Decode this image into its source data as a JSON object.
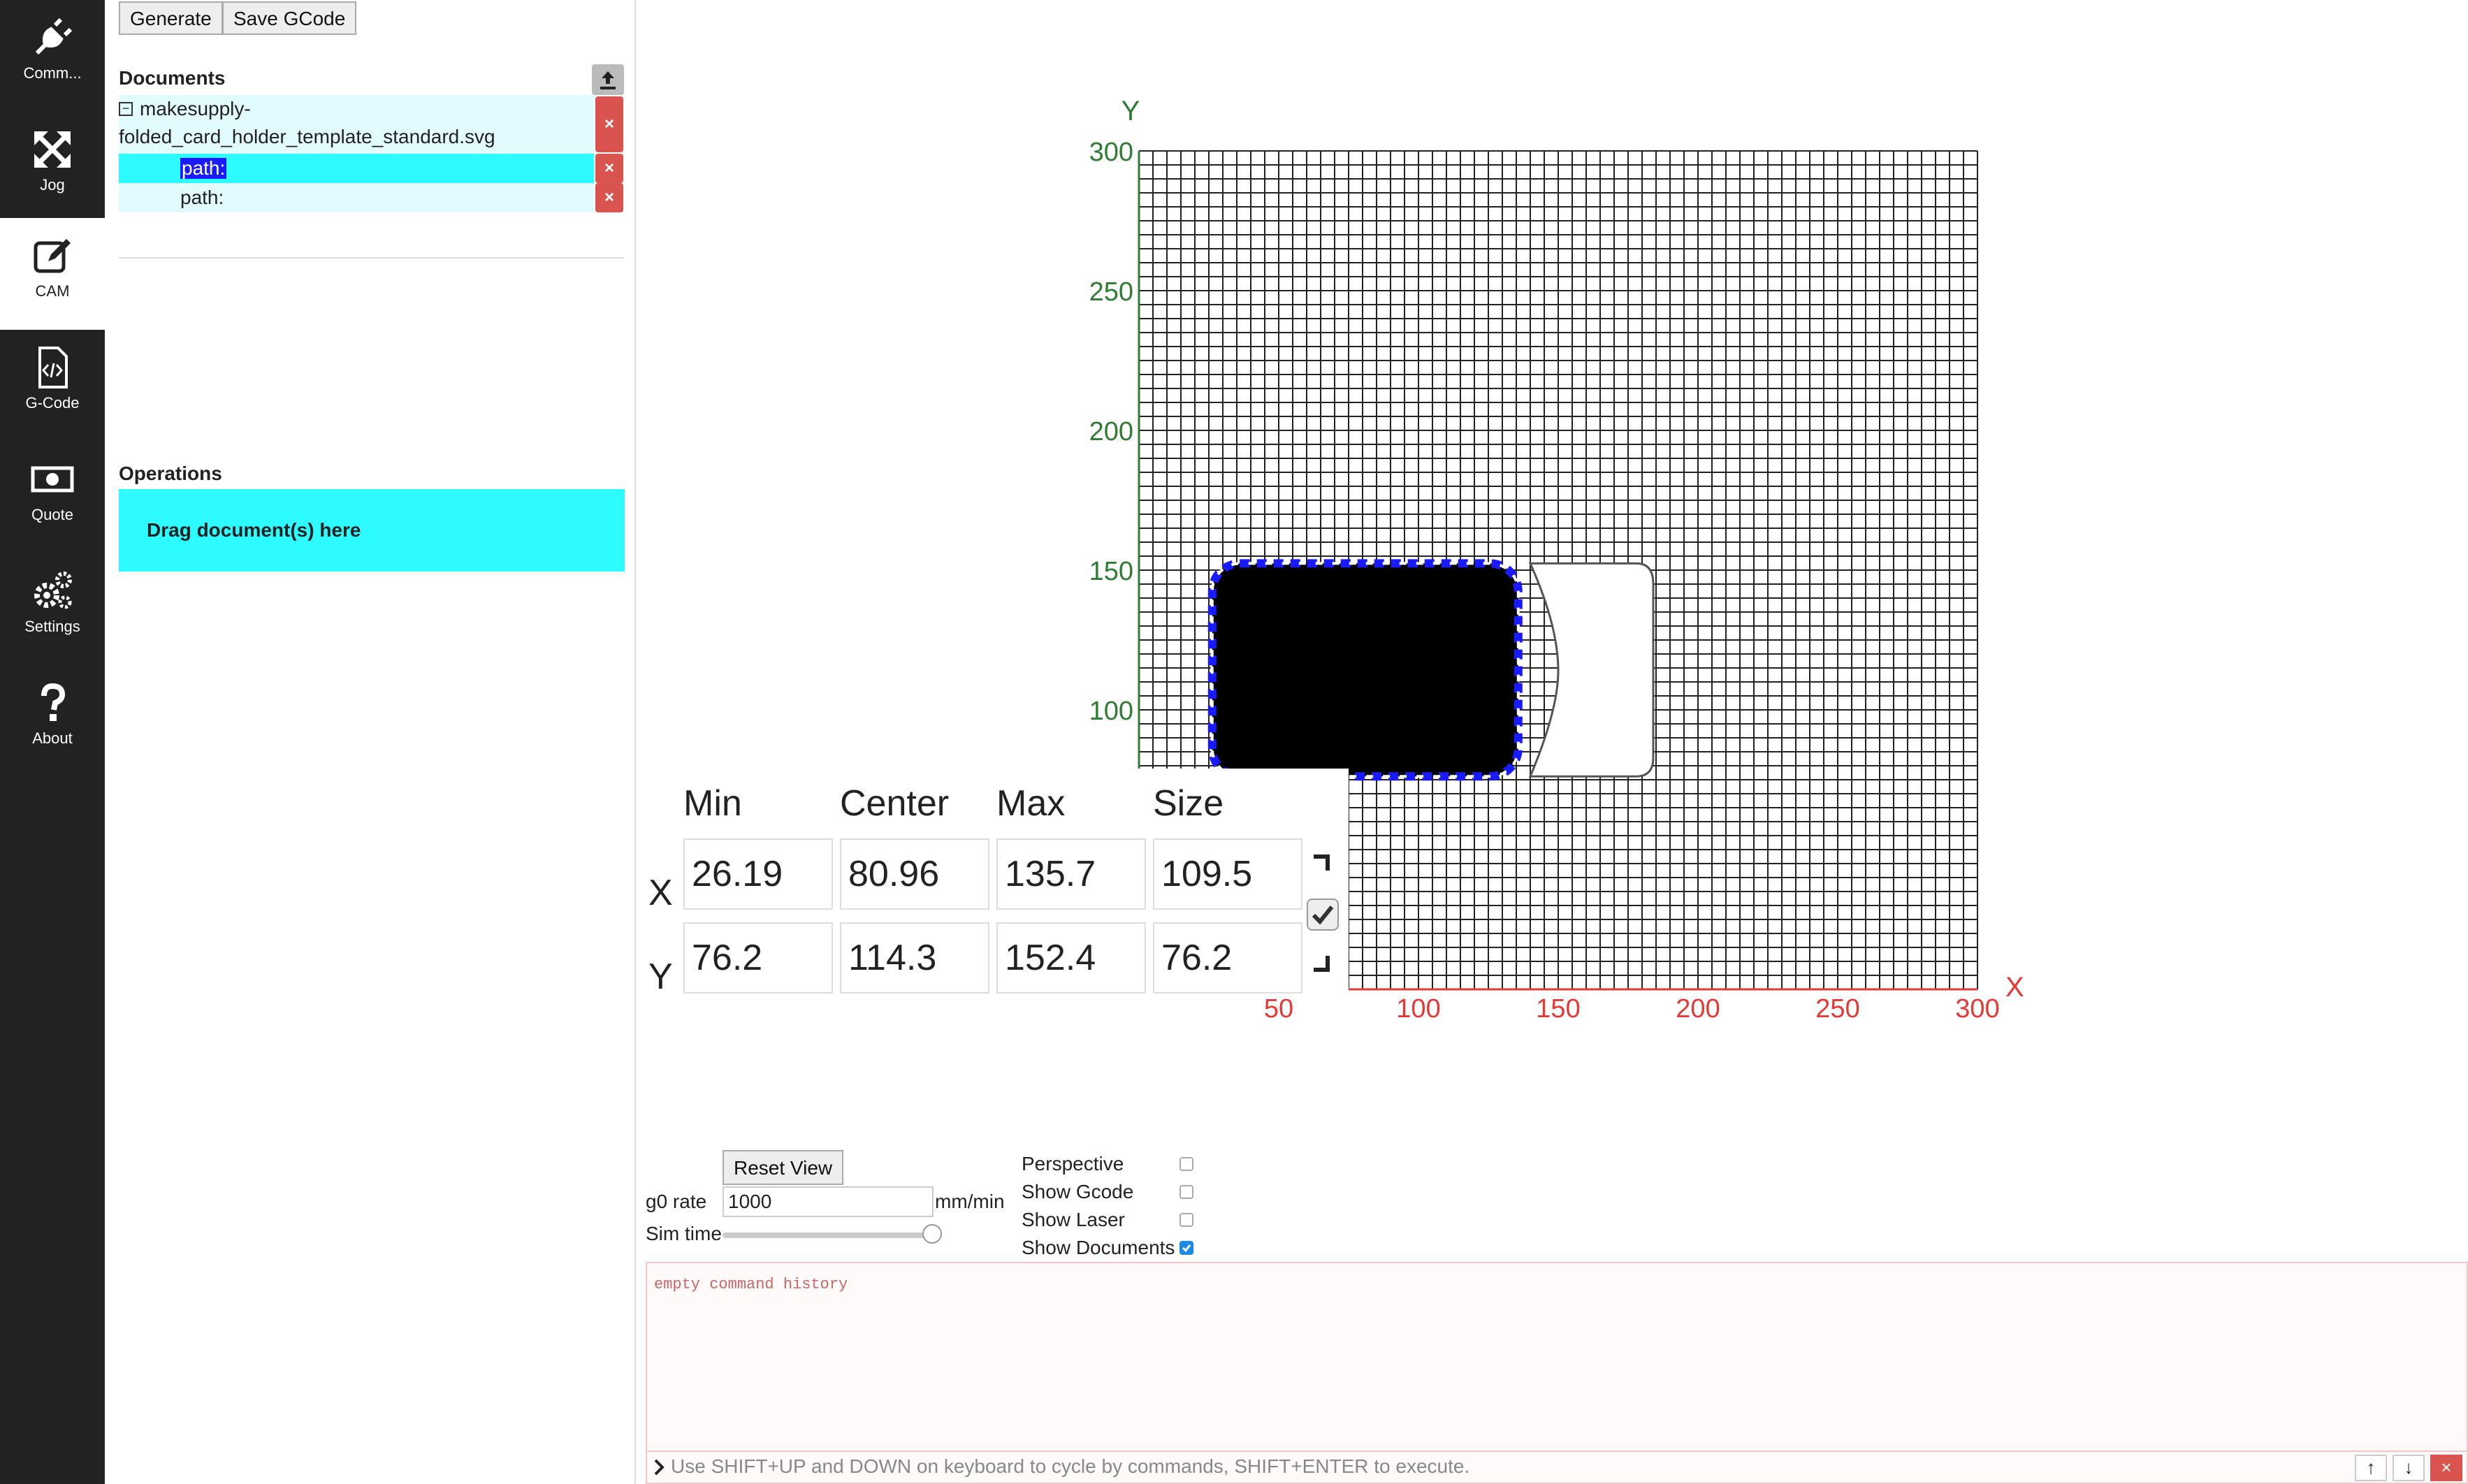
{
  "sidebar": {
    "items": [
      {
        "label": "Comm...",
        "icon": "plug-icon"
      },
      {
        "label": "Jog",
        "icon": "move-icon"
      },
      {
        "label": "CAM",
        "icon": "edit-icon"
      },
      {
        "label": "G-Code",
        "icon": "code-file-icon"
      },
      {
        "label": "Quote",
        "icon": "money-icon"
      },
      {
        "label": "Settings",
        "icon": "gears-icon"
      },
      {
        "label": "About",
        "icon": "question-icon"
      }
    ]
  },
  "toolbar": {
    "generate_label": "Generate",
    "save_gcode_label": "Save GCode"
  },
  "documents": {
    "title": "Documents",
    "file_line1": "makesupply-",
    "file_line2": "folded_card_holder_template_standard.svg",
    "paths": [
      "path:",
      "path:"
    ],
    "delete_symbol": "×"
  },
  "operations": {
    "title": "Operations",
    "drop_text": "Drag document(s) here"
  },
  "viewport": {
    "x_label": "X",
    "y_label": "Y",
    "x_ticks": [
      "50",
      "100",
      "150",
      "200",
      "250",
      "300"
    ],
    "y_ticks": [
      "100",
      "150",
      "200",
      "250",
      "300"
    ]
  },
  "bounds": {
    "headers": [
      "Min",
      "Center",
      "Max",
      "Size"
    ],
    "row_x_label": "X",
    "row_y_label": "Y",
    "x": [
      "26.19",
      "80.96",
      "135.7",
      "109.5"
    ],
    "y": [
      "76.2",
      "114.3",
      "152.4",
      "76.2"
    ]
  },
  "controls": {
    "reset_view": "Reset View",
    "g0_rate_label": "g0 rate",
    "g0_rate_value": "1000",
    "g0_rate_unit": "mm/min",
    "sim_time_label": "Sim time",
    "sim_time_fraction": 1.0,
    "perspective": "Perspective",
    "show_gcode": "Show Gcode",
    "show_laser": "Show Laser",
    "show_documents": "Show Documents",
    "checks": {
      "perspective": false,
      "show_gcode": false,
      "show_laser": false,
      "show_documents": true
    }
  },
  "console": {
    "history": "empty command history",
    "placeholder": "Use SHIFT+UP and DOWN on keyboard to cycle by commands, SHIFT+ENTER to execute."
  },
  "colors": {
    "accent": "#2dfbff",
    "danger": "#d9534f",
    "axis_x": "#e53935",
    "axis_y": "#2e7d32",
    "selection": "#1a1aff"
  }
}
